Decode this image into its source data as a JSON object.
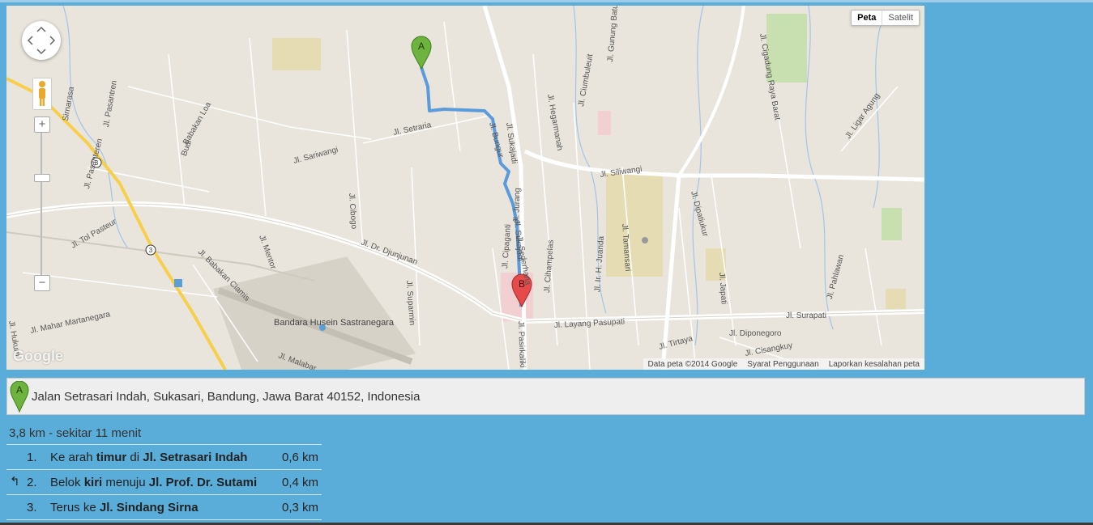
{
  "map": {
    "type_buttons": {
      "map": "Peta",
      "satellite": "Satelit"
    },
    "logo": "Google",
    "attribution": {
      "data": "Data peta ©2014 Google",
      "terms": "Syarat Penggunaan",
      "report": "Laporkan kesalahan peta"
    },
    "markers": {
      "start": "A",
      "end": "B"
    },
    "street_labels": {
      "setraria": "Jl. Setraria",
      "sariwangi": "Jl. Sariwangi",
      "sukajadi": "Jl. Sukajadi",
      "sukajadi2": "Jl. Sukajadi",
      "bungur": "Jl. Bungur",
      "hegarmanah": "Jl. Hegarmanah",
      "ciumbuleuit": "Jl. Ciumbuleuit",
      "gunung_batu": "Jl. Gunung Batu",
      "cigadung": "Jl. Cigadung Raya Barat",
      "ligar_agung": "Jl. Ligar Agung",
      "siliwangi": "Jl. Siliwangi",
      "djunjunan": "Jl. Dr. Djunjunan",
      "tol_pasteur": "Jl. Tol Pasteur",
      "layang_pasupati": "Jl. Layang Pasupati",
      "surapati": "Jl. Surapati",
      "diponegoro": "Jl. Diponegoro",
      "pasirkaliki": "Jl. Pasirkaliki",
      "cipaganti": "Jl. Cipaganti",
      "cihampelas": "Jl. Cihampelas",
      "tamansari": "Jl. Tamansari",
      "juanda": "Jl. Ir. H. Juanda",
      "dipatiukur": "Jl. Dipatiukur",
      "japati": "Jl. Japati",
      "pahlawan": "Jl. Pahlawan",
      "pasantren": "Jl. Pasantren",
      "pasanteren": "Jl. Pasanteren",
      "sirnarasa": "Sirnarasa",
      "budi": "Budi",
      "babakan_loa": "Babakan Loa",
      "cibogo": "Jl. Cibogo",
      "babakan_ciamis": "Jl. Babakan Ciamis",
      "mentor": "Jl. Mentor",
      "mahar": "Jl. Mahar Martanegara",
      "supamin": "Jl. Suparmin",
      "sederhana": "Jl. Sederhana",
      "jurang": "Jl. Jurang",
      "tirtaya": "Jl. Tirtaya",
      "cisangkuy": "Jl. Cisangkuy",
      "hukum": "Jl. Hukum",
      "malabar": "Jl. Malabar"
    },
    "airport": "Bandara Husein Sastranegara",
    "road_numbers": {
      "r1": "3",
      "r2": "3"
    }
  },
  "address": {
    "marker": "A",
    "text": "Jalan Setrasari Indah, Sukasari, Bandung, Jawa Barat 40152, Indonesia"
  },
  "directions": {
    "summary": "3,8 km - sekitar 11 menit",
    "steps": [
      {
        "num": "1.",
        "pre": "Ke arah ",
        "b1": "timur",
        "mid": " di ",
        "b2": "Jl. Setrasari Indah",
        "dist": "0,6 km",
        "turn": ""
      },
      {
        "num": "2.",
        "pre": "Belok ",
        "b1": "kiri",
        "mid": " menuju ",
        "b2": "Jl. Prof. Dr. Sutami",
        "dist": "0,4 km",
        "turn": "↰"
      },
      {
        "num": "3.",
        "pre": "Terus ke ",
        "b1": "",
        "mid": "",
        "b2": "Jl. Sindang Sirna",
        "dist": "0,3 km",
        "turn": ""
      }
    ]
  }
}
